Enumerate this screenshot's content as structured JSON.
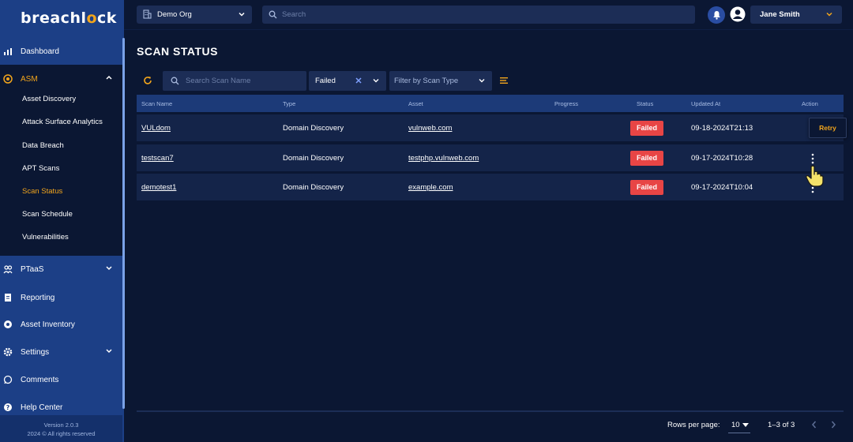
{
  "app": {
    "logo_pre": "breachl",
    "logo_ring": "o",
    "logo_post": "ck",
    "version": "Version 2.0.3",
    "copyright": "2024 © All rights reserved"
  },
  "sidebar": {
    "items": [
      {
        "label": "Dashboard",
        "icon": "chart-bar-icon"
      },
      {
        "label": "ASM",
        "icon": "target-icon"
      },
      {
        "label": "PTaaS",
        "icon": "users-icon"
      },
      {
        "label": "Reporting",
        "icon": "report-icon"
      },
      {
        "label": "Asset Inventory",
        "icon": "inventory-icon"
      },
      {
        "label": "Settings",
        "icon": "gear-icon"
      },
      {
        "label": "Comments",
        "icon": "comment-icon"
      },
      {
        "label": "Help Center",
        "icon": "help-icon"
      }
    ],
    "asm_items": [
      {
        "label": "Asset Discovery"
      },
      {
        "label": "Attack Surface Analytics"
      },
      {
        "label": "Data Breach"
      },
      {
        "label": "APT Scans"
      },
      {
        "label": "Scan Status",
        "active": true
      },
      {
        "label": "Scan Schedule"
      },
      {
        "label": "Vulnerabilities"
      }
    ]
  },
  "topbar": {
    "org": "Demo Org",
    "search_placeholder": "Search",
    "user": "Jane Smith"
  },
  "main": {
    "title": "SCAN STATUS",
    "filters": {
      "search_placeholder": "Search Scan Name",
      "status_value": "Failed",
      "type_placeholder": "Filter by Scan Type"
    },
    "columns": [
      "Scan Name",
      "Type",
      "Asset",
      "Progress",
      "Status",
      "Updated At",
      "Action"
    ],
    "rows": [
      {
        "name": "VULdom",
        "type": "Domain Discovery",
        "asset": "vulnweb.com",
        "status": "Failed",
        "updated": "09-18-2024T21:13"
      },
      {
        "name": "testscan7",
        "type": "Domain Discovery",
        "asset": "testphp.vulnweb.com",
        "status": "Failed",
        "updated": "09-17-2024T10:28"
      },
      {
        "name": "demotest1",
        "type": "Domain Discovery",
        "asset": "example.com",
        "status": "Failed",
        "updated": "09-17-2024T10:04"
      }
    ],
    "retry_label": "Retry",
    "pagination": {
      "rows_per_page_label": "Rows per page:",
      "rows_per_page": "10",
      "range": "1–3 of 3"
    }
  },
  "colors": {
    "accent": "#f2a51c",
    "sidebar": "#1c3f86",
    "background": "#0b1733",
    "failed": "#e84545"
  }
}
